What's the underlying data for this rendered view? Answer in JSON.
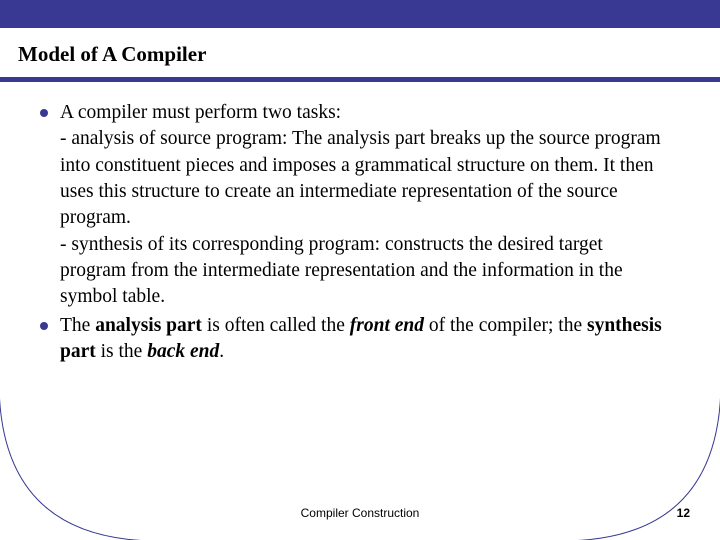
{
  "slide": {
    "title": "Model of A Compiler",
    "bullets": [
      {
        "lead": "A compiler must perform two tasks:",
        "sub1": " - analysis of source program: The analysis part breaks up the source program into constituent pieces and imposes a grammatical structure on them. It then uses this structure to create an intermediate representation of the source program.",
        "sub2": " - synthesis of its corresponding program: constructs the desired target program from the intermediate representation and the information in the symbol table."
      },
      {
        "pre": "The ",
        "b1": "analysis part",
        "mid1": " is often called the ",
        "bi1": "front end",
        "mid2": " of the compiler; the ",
        "b2": "synthesis part",
        "mid3": " is the ",
        "bi2": "back end",
        "post": "."
      }
    ]
  },
  "footer": {
    "center": "Compiler Construction",
    "page": "12"
  },
  "colors": {
    "accent": "#393993"
  }
}
